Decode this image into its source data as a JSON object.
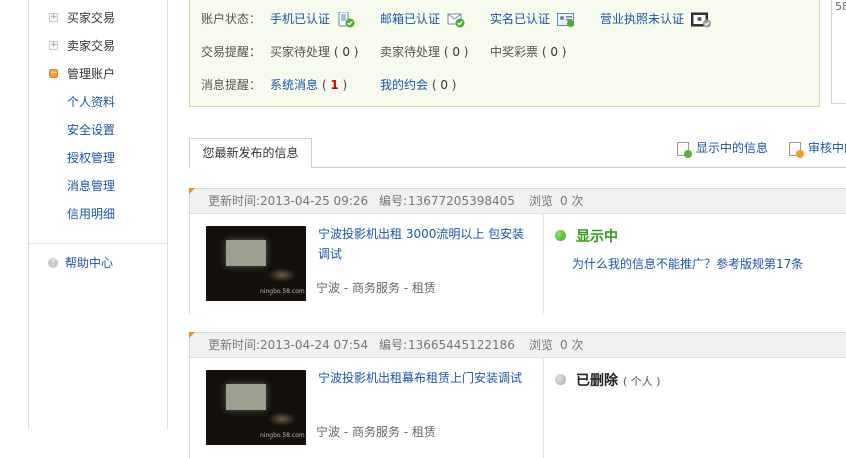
{
  "sidebar": {
    "items": [
      {
        "label": "买家交易",
        "expanded": false
      },
      {
        "label": "卖家交易",
        "expanded": false
      },
      {
        "label": "管理账户",
        "expanded": true
      }
    ],
    "subitems": [
      "个人资料",
      "安全设置",
      "授权管理",
      "消息管理",
      "信用明细"
    ],
    "help": "帮助中心"
  },
  "account": {
    "status_label": "账户状态：",
    "status_items": [
      "手机已认证",
      "邮箱已认证",
      "实名已认证",
      "营业执照未认证"
    ],
    "trade_label": "交易提醒：",
    "trade_items": [
      {
        "label": "买家待处理",
        "count": "0"
      },
      {
        "label": "卖家待处理",
        "count": "0"
      },
      {
        "label": "中奖彩票",
        "count": "0"
      }
    ],
    "msg_label": "消息提醒：",
    "msg_items": [
      {
        "label": "系统消息",
        "count": "1"
      },
      {
        "label": "我的约会",
        "count": "0"
      }
    ]
  },
  "right_panel_partial": "58",
  "tabs": {
    "active": "您最新发布的信息",
    "links": [
      "显示中的信息",
      "审核中的"
    ]
  },
  "listings": [
    {
      "updated_label": "更新时间:",
      "updated": "2013-04-25 09:26",
      "id_label": "编号:",
      "id": "13677205398405",
      "views_label": "浏览",
      "views": "0 次",
      "title": "宁波投影机出租 3000流明以上 包安装调试",
      "category": "宁波 - 商务服务 - 租赁",
      "status": "显示中",
      "status_sub": "",
      "promo": "为什么我的信息不能推广？参考版规第17条",
      "thumb_watermark": "ningbo.58.com"
    },
    {
      "updated_label": "更新时间:",
      "updated": "2013-04-24 07:54",
      "id_label": "编号:",
      "id": "13665445122186",
      "views_label": "浏览",
      "views": "0 次",
      "title": "宁波投影机出租幕布租赁上门安装调试",
      "category": "宁波 - 商务服务 - 租赁",
      "status": "已删除",
      "status_sub": "( 个人 )",
      "promo": "",
      "thumb_watermark": "ningbo.58.com"
    }
  ],
  "colors": {
    "link": "#1a55a5",
    "status_green": "#2f9a15",
    "accent_orange": "#f08a24",
    "box_bg": "#f6fbee"
  }
}
